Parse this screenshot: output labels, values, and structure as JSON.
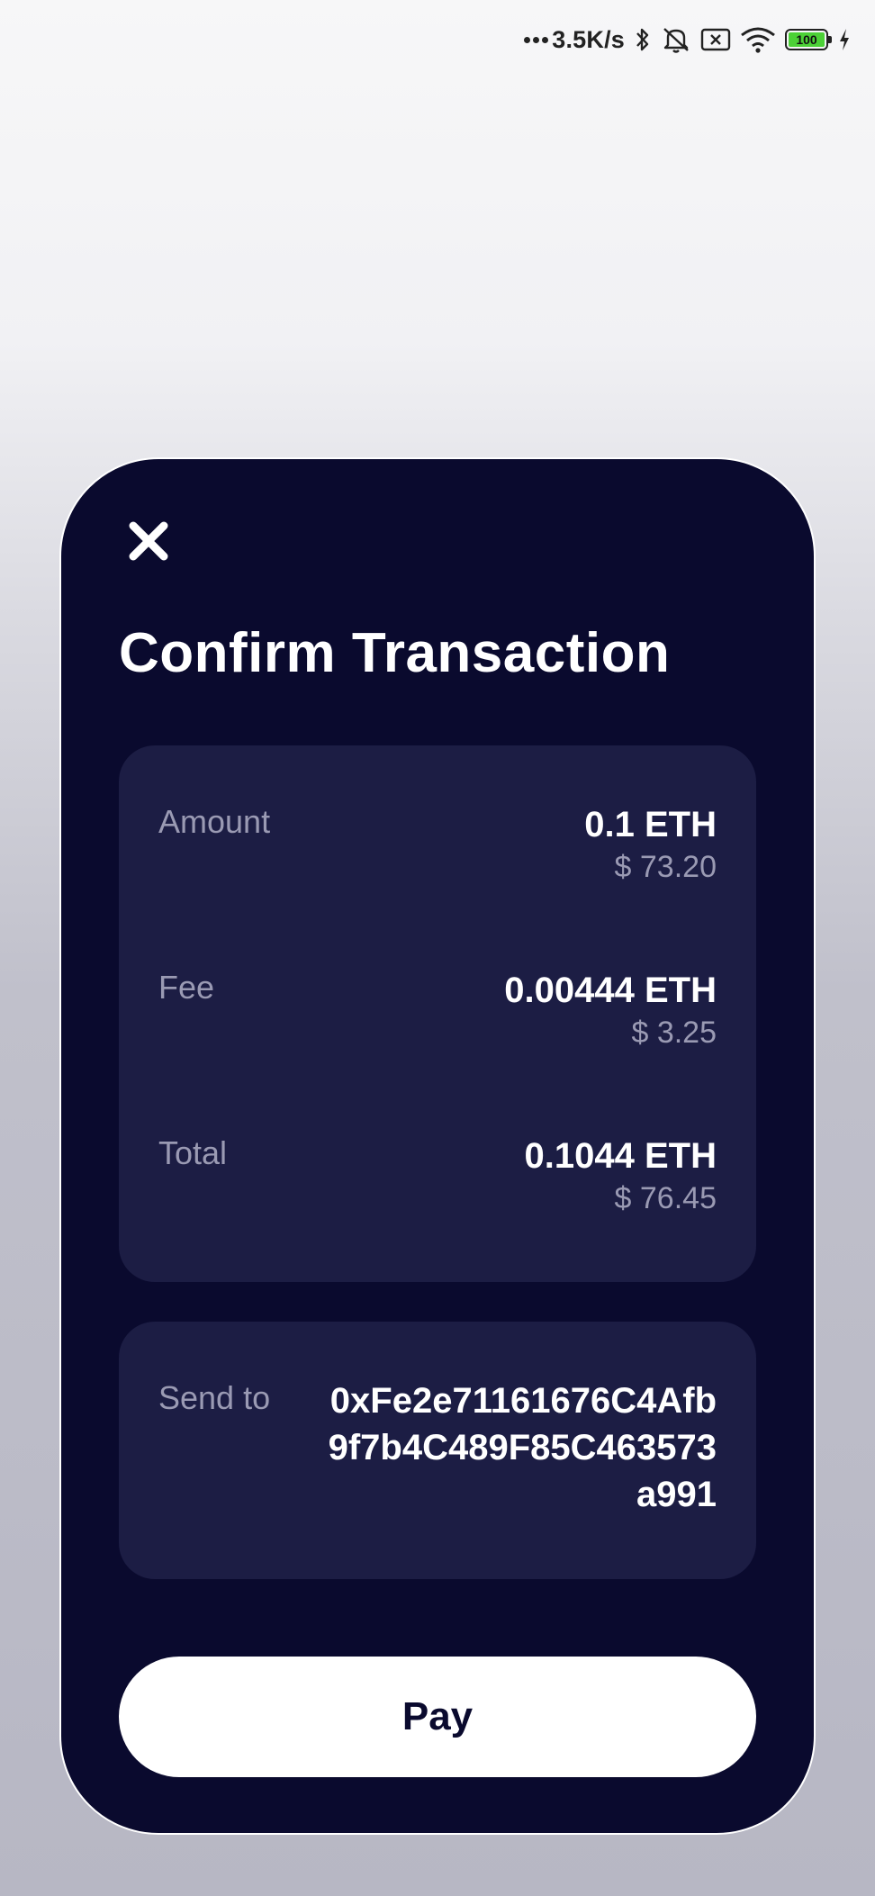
{
  "status_bar": {
    "net_speed": "3.5K/s",
    "battery_level": "100",
    "icons": [
      "more-dots-icon",
      "bluetooth-icon",
      "mute-bell-icon",
      "sim-off-icon",
      "wifi-icon",
      "battery-icon",
      "charging-bolt-icon"
    ],
    "battery_color": "#4cd137"
  },
  "modal": {
    "close_icon": "close-icon",
    "title": "Confirm Transaction",
    "background_color": "#0a0a2e",
    "panel_color": "#1c1d44",
    "amount": {
      "label": "Amount",
      "value": "0.1 ETH",
      "fiat": "$ 73.20"
    },
    "fee": {
      "label": "Fee",
      "value": "0.00444 ETH",
      "fiat": "$ 3.25"
    },
    "total": {
      "label": "Total",
      "value": "0.1044 ETH",
      "fiat": "$ 76.45"
    },
    "send_to": {
      "label": "Send to",
      "address": "0xFe2e71161676C4Afb9f7b4C489F85C463573a991"
    },
    "pay_label": "Pay"
  }
}
